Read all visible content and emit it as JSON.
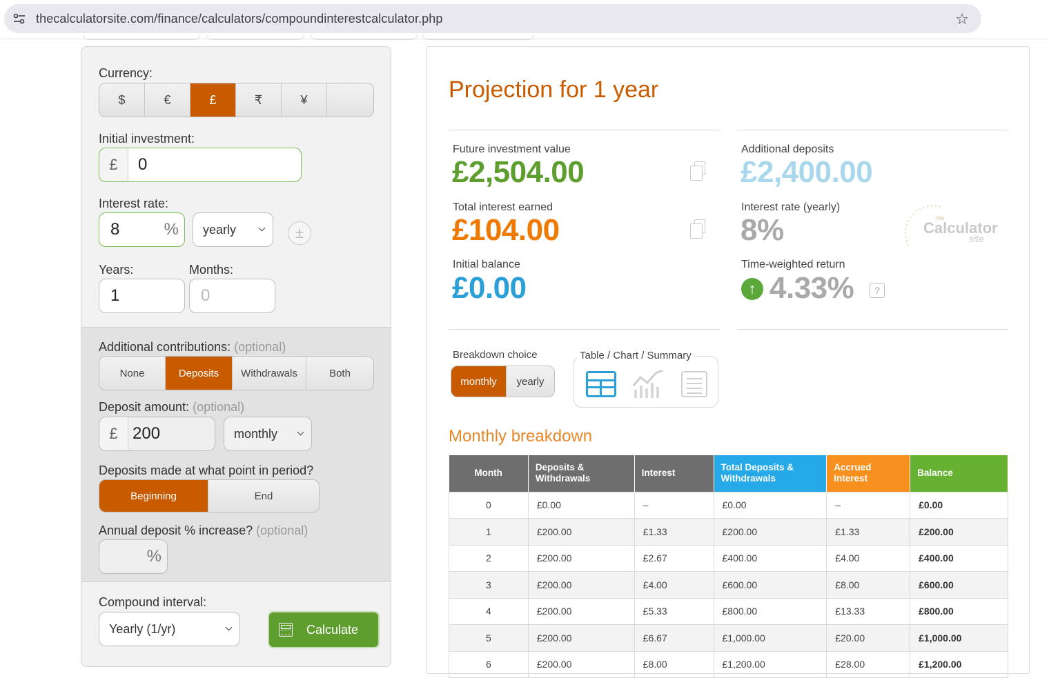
{
  "browser": {
    "url": "thecalculatorsite.com/finance/calculators/compoundinterestcalculator.php"
  },
  "form": {
    "currency_label": "Currency:",
    "currencies": [
      "$",
      "€",
      "£",
      "₹",
      "¥",
      ""
    ],
    "currency_selected": "£",
    "initial_label": "Initial investment:",
    "initial_prefix": "£",
    "initial_value": "0",
    "rate_label": "Interest rate:",
    "rate_value": "8",
    "rate_suffix": "%",
    "rate_period": "yearly",
    "plusminus": "±",
    "years_label": "Years:",
    "years_value": "1",
    "months_label": "Months:",
    "months_placeholder": "0",
    "contrib_label": "Additional contributions:",
    "optional": "(optional)",
    "contrib_options": [
      "None",
      "Deposits",
      "Withdrawals",
      "Both"
    ],
    "contrib_selected": "Deposits",
    "deposit_label": "Deposit amount:",
    "deposit_prefix": "£",
    "deposit_value": "200",
    "deposit_freq": "monthly",
    "point_label": "Deposits made at what point in period?",
    "point_options": [
      "Beginning",
      "End"
    ],
    "point_selected": "Beginning",
    "increase_label": "Annual deposit % increase?",
    "increase_suffix": "%",
    "compound_label": "Compound interval:",
    "compound_value": "Yearly (1/yr)",
    "calculate_label": "Calculate"
  },
  "results": {
    "title": "Projection for 1 year",
    "future_label": "Future investment value",
    "future_value": "£2,504.00",
    "interest_label": "Total interest earned",
    "interest_value": "£104.00",
    "initial_label": "Initial balance",
    "initial_value": "£0.00",
    "deposits_label": "Additional deposits",
    "deposits_value": "£2,400.00",
    "rate_label": "Interest rate (yearly)",
    "rate_value": "8%",
    "twr_label": "Time-weighted return",
    "twr_value": "4.33%",
    "help": "?",
    "logo": {
      "text": "Calculator",
      "small": "the",
      "site": "site",
      "digits": "1234567890"
    },
    "colors": {
      "future": "#5e9e2e",
      "interest": "#ee7a00",
      "initial": "#2a9fd8",
      "deposits": "#a9d8ec",
      "grey": "#a9a9a9",
      "accent": "#c85a00"
    }
  },
  "breakdown": {
    "choice_label": "Breakdown choice",
    "choices": [
      "monthly",
      "yearly"
    ],
    "choice_selected": "monthly",
    "view_label": "Table / Chart / Summary",
    "title": "Monthly breakdown",
    "columns": [
      "Month",
      "Deposits & Withdrawals",
      "Interest",
      "Total Deposits & Withdrawals",
      "Accrued Interest",
      "Balance"
    ],
    "rows": [
      [
        "0",
        "£0.00",
        "–",
        "£0.00",
        "–",
        "£0.00"
      ],
      [
        "1",
        "£200.00",
        "£1.33",
        "£200.00",
        "£1.33",
        "£200.00"
      ],
      [
        "2",
        "£200.00",
        "£2.67",
        "£400.00",
        "£4.00",
        "£400.00"
      ],
      [
        "3",
        "£200.00",
        "£4.00",
        "£600.00",
        "£8.00",
        "£600.00"
      ],
      [
        "4",
        "£200.00",
        "£5.33",
        "£800.00",
        "£13.33",
        "£800.00"
      ],
      [
        "5",
        "£200.00",
        "£6.67",
        "£1,000.00",
        "£20.00",
        "£1,000.00"
      ],
      [
        "6",
        "£200.00",
        "£8.00",
        "£1,200.00",
        "£28.00",
        "£1,200.00"
      ]
    ]
  }
}
